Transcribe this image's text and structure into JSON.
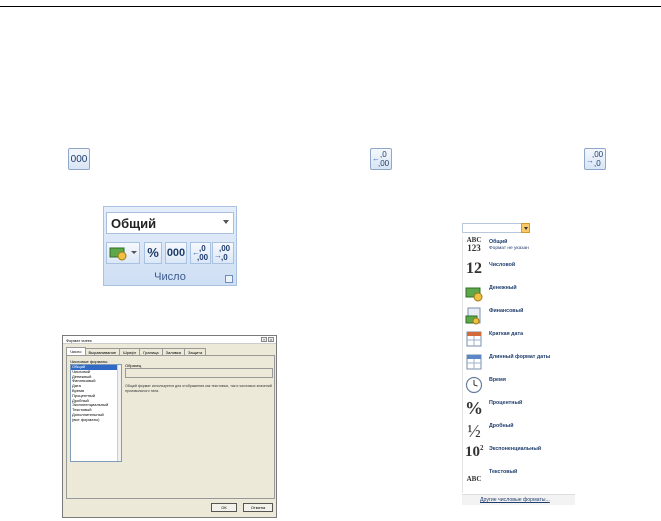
{
  "icons_row": {
    "thousands_label": "000",
    "increase_decimal_top": ",0",
    "increase_decimal_bottom": ",00",
    "decrease_decimal_top": ",00",
    "decrease_decimal_bottom": ",0"
  },
  "ribbon": {
    "format_value": "Общий",
    "percent": "%",
    "thousands": "000",
    "inc_top": ",0",
    "inc_bottom": ",00",
    "dec_top": ",00",
    "dec_bottom": ",0",
    "group_label": "Число"
  },
  "dialog": {
    "title": "Формат ячеек",
    "close": "X",
    "help": "?",
    "tabs": [
      "Число",
      "Выравнивание",
      "Шрифт",
      "Граница",
      "Заливка",
      "Защита"
    ],
    "categories_caption": "Числовые форматы:",
    "categories": [
      "Общий",
      "Числовой",
      "Денежный",
      "Финансовый",
      "Дата",
      "Время",
      "Процентный",
      "Дробный",
      "Экспоненциальный",
      "Текстовый",
      "Дополнительный",
      "(все форматы)"
    ],
    "sample_label": "Образец",
    "description": "Общий формат используется для отображения как текстовых, так и числовых значений произвольного типа.",
    "ok": "ОК",
    "cancel": "Отмена"
  },
  "dropdown": {
    "items": [
      {
        "icon": "ABC 123",
        "label": "Общий",
        "sub": "Формат не указан"
      },
      {
        "icon": "12",
        "label": "Числовой",
        "sub": ""
      },
      {
        "icon": "money",
        "label": "Денежный",
        "sub": ""
      },
      {
        "icon": "finance",
        "label": "Финансовый",
        "sub": ""
      },
      {
        "icon": "calendar",
        "label": "Краткая дата",
        "sub": ""
      },
      {
        "icon": "calendar",
        "label": "Длинный формат даты",
        "sub": ""
      },
      {
        "icon": "clock",
        "label": "Время",
        "sub": ""
      },
      {
        "icon": "%",
        "label": "Процентный",
        "sub": ""
      },
      {
        "icon": "½",
        "label": "Дробный",
        "sub": ""
      },
      {
        "icon": "10²",
        "label": "Экспоненциальный",
        "sub": ""
      },
      {
        "icon": "ABC",
        "label": "Текстовый",
        "sub": ""
      }
    ],
    "more": "Другие числовые форматы..."
  }
}
